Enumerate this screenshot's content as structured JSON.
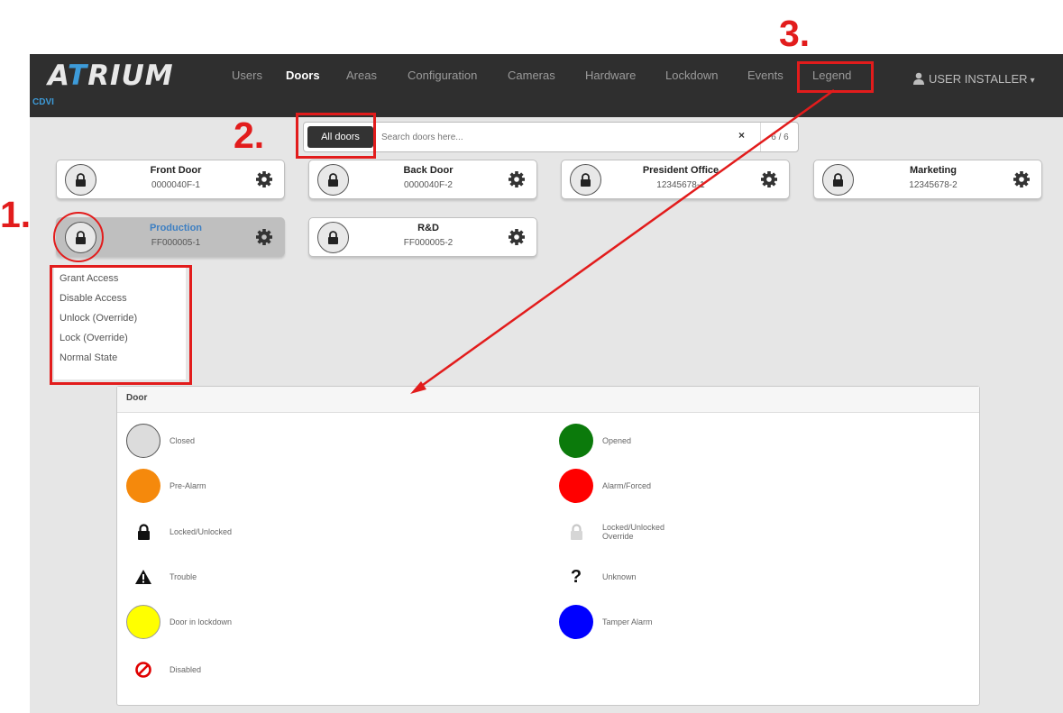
{
  "brand": {
    "logo_a": "A",
    "logo_t": "T",
    "logo_rest": "RIUM",
    "sub": "CDVI"
  },
  "nav": {
    "users": "Users",
    "doors": "Doors",
    "areas": "Areas",
    "configuration": "Configuration",
    "cameras": "Cameras",
    "hardware": "Hardware",
    "lockdown": "Lockdown",
    "events": "Events",
    "legend": "Legend"
  },
  "user": {
    "label": "USER INSTALLER"
  },
  "search": {
    "filter_label": "All doors",
    "placeholder": "Search doors here...",
    "clear": "×",
    "count": "6 / 6"
  },
  "doors": [
    {
      "name": "Front Door",
      "id": "0000040F-1"
    },
    {
      "name": "Back Door",
      "id": "0000040F-2"
    },
    {
      "name": "President Office",
      "id": "12345678-1"
    },
    {
      "name": "Marketing",
      "id": "12345678-2"
    },
    {
      "name": "Production",
      "id": "FF000005-1"
    },
    {
      "name": "R&D",
      "id": "FF000005-2"
    }
  ],
  "context_menu": [
    "Grant Access",
    "Disable Access",
    "Unlock (Override)",
    "Lock (Override)",
    "Normal State"
  ],
  "legend": {
    "title": "Door",
    "items": [
      {
        "label": "Closed",
        "color": "#dcdcdc"
      },
      {
        "label": "Opened",
        "color": "#0b7a0b"
      },
      {
        "label": "Pre-Alarm",
        "color": "#f5890c"
      },
      {
        "label": "Alarm/Forced",
        "color": "#ff0000"
      },
      {
        "label": "Locked/Unlocked",
        "icon": "lock-icon"
      },
      {
        "label": "Locked/Unlocked Override",
        "icon": "lock-override-icon"
      },
      {
        "label": "Trouble",
        "icon": "warning-icon"
      },
      {
        "label": "Unknown",
        "icon": "question-icon"
      },
      {
        "label": "Door in lockdown",
        "color": "#ffff00"
      },
      {
        "label": "Tamper Alarm",
        "color": "#0000ff"
      },
      {
        "label": "Disabled",
        "icon": "disabled-icon"
      }
    ]
  },
  "annotations": {
    "one": "1.",
    "two": "2.",
    "three": "3."
  },
  "colors": {
    "annotation": "#e21c1c",
    "navbar": "#2f2f2f",
    "accent": "#3d9bd9"
  }
}
